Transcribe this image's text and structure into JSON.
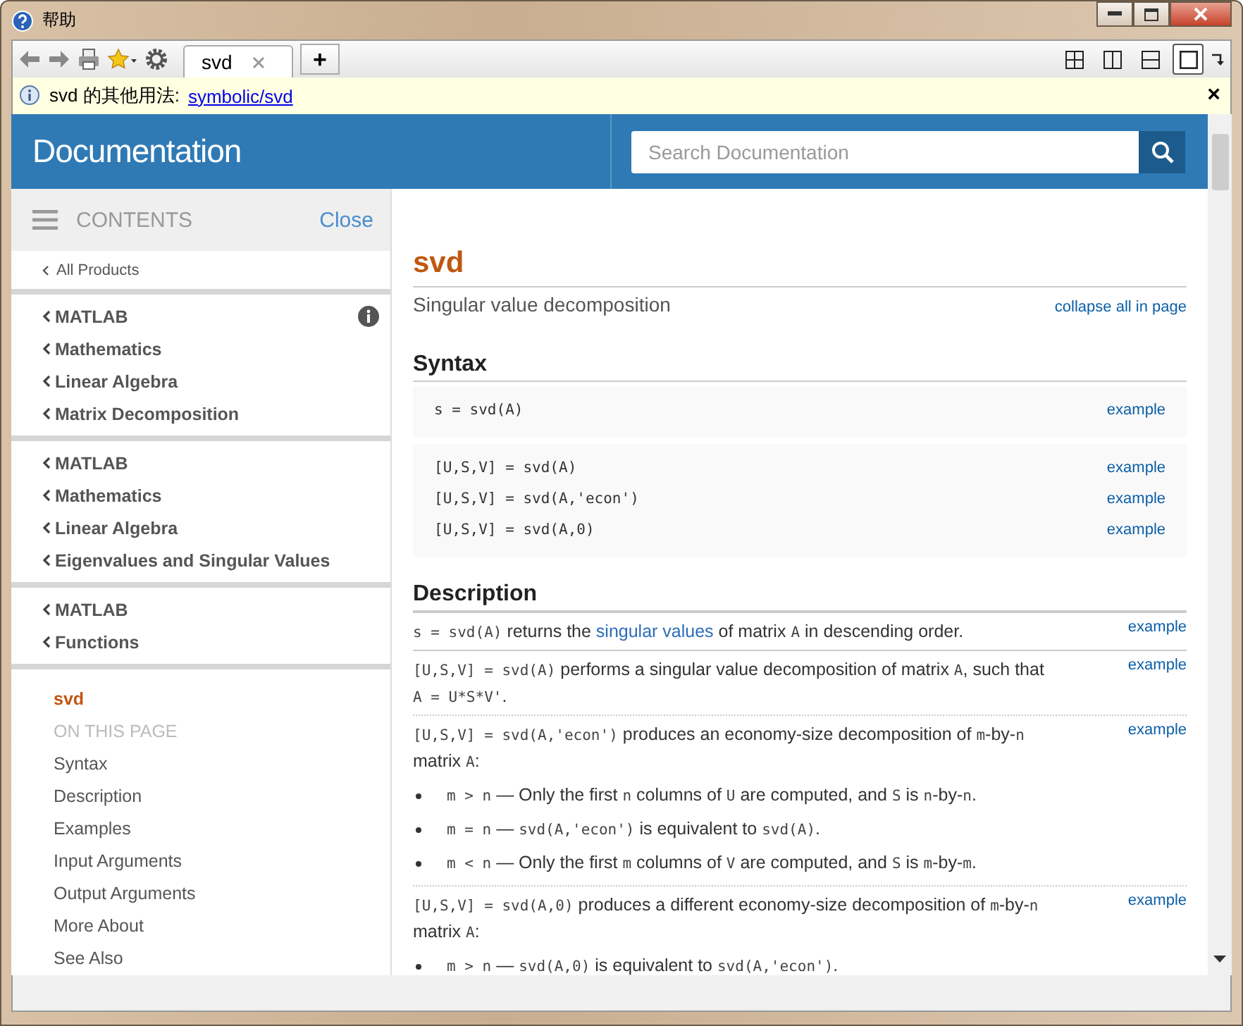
{
  "window": {
    "title": "帮助"
  },
  "toolbar": {
    "tabs": [
      {
        "label": "svd",
        "selected": true
      }
    ],
    "new_tab": "+",
    "layout_buttons": [
      {
        "kind": "grid",
        "selected": false
      },
      {
        "kind": "columns",
        "selected": false
      },
      {
        "kind": "rows",
        "selected": false
      },
      {
        "kind": "single",
        "selected": true
      }
    ]
  },
  "info_bar": {
    "text": "svd 的其他用法:",
    "link": "symbolic/svd",
    "close": "×"
  },
  "header": {
    "title": "Documentation",
    "search": {
      "placeholder": "Search Documentation"
    }
  },
  "sidebar": {
    "label": "CONTENTS",
    "close": "Close",
    "all_products": "All Products",
    "groups": [
      {
        "info": true,
        "items": [
          "MATLAB",
          "Mathematics",
          "Linear Algebra",
          "Matrix Decomposition"
        ]
      },
      {
        "info": false,
        "items": [
          "MATLAB",
          "Mathematics",
          "Linear Algebra",
          "Eigenvalues and Singular Values"
        ]
      },
      {
        "info": false,
        "items": [
          "MATLAB",
          "Functions"
        ]
      }
    ],
    "current": "svd",
    "on_this_page": "ON THIS PAGE",
    "sections": [
      "Syntax",
      "Description",
      "Examples",
      "Input Arguments",
      "Output Arguments",
      "More About",
      "See Also"
    ]
  },
  "page": {
    "title": "svd",
    "subtitle": "Singular value decomposition",
    "collapse": "collapse all in page",
    "syntax": {
      "heading": "Syntax",
      "blocks": [
        [
          {
            "code": "s = svd(A)",
            "link": "example"
          }
        ],
        [
          {
            "code": "[U,S,V] = svd(A)",
            "link": "example"
          },
          {
            "code": "[U,S,V] = svd(A,'econ')",
            "link": "example"
          },
          {
            "code": "[U,S,V] = svd(A,0)",
            "link": "example"
          }
        ]
      ]
    },
    "description": {
      "heading": "Description",
      "items": [
        {
          "link": "example",
          "segments": [
            {
              "kind": "code",
              "text": "s = svd(A)"
            },
            {
              "kind": "text",
              "text": " returns the "
            },
            {
              "kind": "link",
              "text": "singular values"
            },
            {
              "kind": "text",
              "text": " of matrix "
            },
            {
              "kind": "code",
              "text": "A"
            },
            {
              "kind": "text",
              "text": " in descending order."
            }
          ]
        },
        {
          "link": "example",
          "segments": [
            {
              "kind": "code",
              "text": "[U,S,V] = svd(A)"
            },
            {
              "kind": "text",
              "text": " performs a singular value decomposition of matrix "
            },
            {
              "kind": "code",
              "text": "A"
            },
            {
              "kind": "text",
              "text": ", such that "
            },
            {
              "kind": "code",
              "text": "A = U*S*V'"
            },
            {
              "kind": "text",
              "text": "."
            }
          ]
        },
        {
          "link": "example",
          "segments": [
            {
              "kind": "code",
              "text": "[U,S,V] = svd(A,'econ')"
            },
            {
              "kind": "text",
              "text": " produces an economy-size decomposition of "
            },
            {
              "kind": "code",
              "text": "m"
            },
            {
              "kind": "text",
              "text": "-by-"
            },
            {
              "kind": "code",
              "text": "n"
            },
            {
              "kind": "text",
              "text": " matrix "
            },
            {
              "kind": "code",
              "text": "A"
            },
            {
              "kind": "text",
              "text": ":"
            }
          ],
          "bullets": [
            [
              {
                "kind": "code",
                "text": "m > n"
              },
              {
                "kind": "text",
                "text": " — Only the first "
              },
              {
                "kind": "code",
                "text": "n"
              },
              {
                "kind": "text",
                "text": " columns of "
              },
              {
                "kind": "code",
                "text": "U"
              },
              {
                "kind": "text",
                "text": " are computed, and "
              },
              {
                "kind": "code",
                "text": "S"
              },
              {
                "kind": "text",
                "text": " is "
              },
              {
                "kind": "code",
                "text": "n"
              },
              {
                "kind": "text",
                "text": "-by-"
              },
              {
                "kind": "code",
                "text": "n"
              },
              {
                "kind": "text",
                "text": "."
              }
            ],
            [
              {
                "kind": "code",
                "text": "m = n"
              },
              {
                "kind": "text",
                "text": " — "
              },
              {
                "kind": "code",
                "text": "svd(A,'econ')"
              },
              {
                "kind": "text",
                "text": " is equivalent to "
              },
              {
                "kind": "code",
                "text": "svd(A)"
              },
              {
                "kind": "text",
                "text": "."
              }
            ],
            [
              {
                "kind": "code",
                "text": "m < n"
              },
              {
                "kind": "text",
                "text": " — Only the first "
              },
              {
                "kind": "code",
                "text": "m"
              },
              {
                "kind": "text",
                "text": " columns of "
              },
              {
                "kind": "code",
                "text": "V"
              },
              {
                "kind": "text",
                "text": " are computed, and "
              },
              {
                "kind": "code",
                "text": "S"
              },
              {
                "kind": "text",
                "text": " is "
              },
              {
                "kind": "code",
                "text": "m"
              },
              {
                "kind": "text",
                "text": "-by-"
              },
              {
                "kind": "code",
                "text": "m"
              },
              {
                "kind": "text",
                "text": "."
              }
            ]
          ]
        },
        {
          "link": "example",
          "segments": [
            {
              "kind": "code",
              "text": "[U,S,V] = svd(A,0)"
            },
            {
              "kind": "text",
              "text": " produces a different economy-size decomposition of "
            },
            {
              "kind": "code",
              "text": "m"
            },
            {
              "kind": "text",
              "text": "-by-"
            },
            {
              "kind": "code",
              "text": "n"
            },
            {
              "kind": "text",
              "text": " matrix "
            },
            {
              "kind": "code",
              "text": "A"
            },
            {
              "kind": "text",
              "text": ":"
            }
          ],
          "bullets": [
            [
              {
                "kind": "code",
                "text": "m > n"
              },
              {
                "kind": "text",
                "text": " — "
              },
              {
                "kind": "code",
                "text": "svd(A,0)"
              },
              {
                "kind": "text",
                "text": " is equivalent to "
              },
              {
                "kind": "code",
                "text": "svd(A,'econ')"
              },
              {
                "kind": "text",
                "text": "."
              }
            ]
          ]
        }
      ]
    }
  }
}
